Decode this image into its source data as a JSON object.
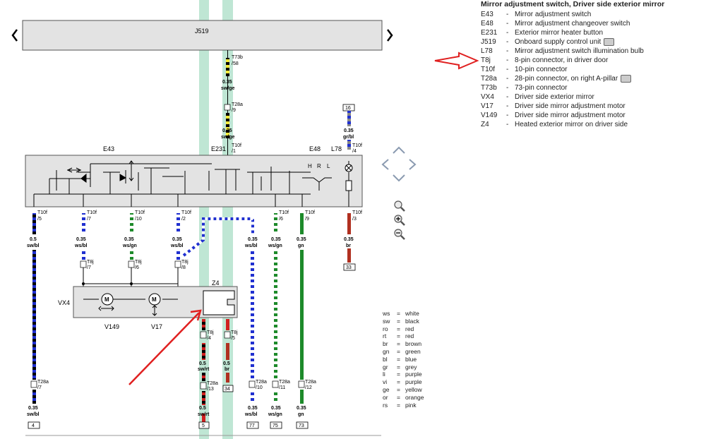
{
  "legend": {
    "title": "Mirror adjustment switch, Driver side exterior mirror",
    "items": [
      {
        "code": "E43",
        "desc": "Mirror adjustment switch",
        "camera": false
      },
      {
        "code": "E48",
        "desc": "Mirror adjustment changeover switch",
        "camera": false
      },
      {
        "code": "E231",
        "desc": "Exterior mirror heater button",
        "camera": false
      },
      {
        "code": "J519",
        "desc": "Onboard supply control unit",
        "camera": true
      },
      {
        "code": "L78",
        "desc": "Mirror adjustment switch illumination bulb",
        "camera": false
      },
      {
        "code": "T8j",
        "desc": "8-pin connector, in driver door",
        "camera": false
      },
      {
        "code": "T10f",
        "desc": "10-pin connector",
        "camera": false
      },
      {
        "code": "T28a",
        "desc": "28-pin connector, on right A-pillar",
        "camera": true
      },
      {
        "code": "T73b",
        "desc": "73-pin connector",
        "camera": false
      },
      {
        "code": "VX4",
        "desc": "Driver side exterior mirror",
        "camera": false
      },
      {
        "code": "V17",
        "desc": "Driver side mirror adjustment motor",
        "camera": false
      },
      {
        "code": "V149",
        "desc": "Driver side mirror adjustment motor",
        "camera": false
      },
      {
        "code": "Z4",
        "desc": "Heated exterior mirror on driver side",
        "camera": false
      }
    ]
  },
  "color_codes": [
    {
      "k": "ws",
      "v": "white"
    },
    {
      "k": "sw",
      "v": "black"
    },
    {
      "k": "ro",
      "v": "red"
    },
    {
      "k": "rt",
      "v": "red"
    },
    {
      "k": "br",
      "v": "brown"
    },
    {
      "k": "gn",
      "v": "green"
    },
    {
      "k": "bl",
      "v": "blue"
    },
    {
      "k": "gr",
      "v": "grey"
    },
    {
      "k": "li",
      "v": "purple"
    },
    {
      "k": "vi",
      "v": "purple"
    },
    {
      "k": "ge",
      "v": "yellow"
    },
    {
      "k": "or",
      "v": "orange"
    },
    {
      "k": "rs",
      "v": "pink"
    }
  ],
  "labels": {
    "j519": "J519",
    "e43": "E43",
    "e231": "E231",
    "e48": "E48",
    "l78": "L78",
    "vx4": "VX4",
    "v149": "V149",
    "v17": "V17",
    "z4": "Z4",
    "h": "H",
    "r": "R",
    "l": "L"
  },
  "top_wire": {
    "t73b": "T73b",
    "t73b_pin": "/58",
    "size1": "0.35",
    "color1": "sw/ge",
    "t28a": "T28a",
    "t28a_pin": "/9",
    "size2": "0.35",
    "color2": "sw/ge",
    "t10f": "T10f",
    "t10f_pin": "/1"
  },
  "l78_wire": {
    "term": "16",
    "size": "0.35",
    "color": "gr/bl",
    "t10f": "T10f",
    "pin": "/4"
  },
  "wires": [
    {
      "id": "w5",
      "t10f": "T10f",
      "t10f_pin": "/5",
      "size": "0.5",
      "color": "sw/bl",
      "t28a": "T28a",
      "t28a_pin": "/7",
      "bsize": "0.35",
      "bcolor": "sw/bl",
      "term": "4"
    },
    {
      "id": "w7",
      "t10f": "T10f",
      "t10f_pin": "/7",
      "size": "0.35",
      "color": "ws/bl",
      "t8j": "T8j",
      "t8j_pin": "/7"
    },
    {
      "id": "w10",
      "t10f": "T10f",
      "t10f_pin": "/10",
      "size": "0.35",
      "color": "ws/gn",
      "t8j": "T8j",
      "t8j_pin": "/6"
    },
    {
      "id": "w2",
      "t10f": "T10f",
      "t10f_pin": "/2",
      "size": "0.35",
      "color": "ws/bl",
      "t8j": "T8j",
      "t8j_pin": "/8"
    },
    {
      "id": "wz1",
      "size_top": "0.35",
      "color_top": "ws/bl",
      "t28a": "T28a",
      "t28a_pin": "/10",
      "bsize": "0.35",
      "bcolor": "ws/bl",
      "term": "77"
    },
    {
      "id": "w6",
      "t10f": "T10f",
      "t10f_pin": "/6",
      "size": "0.35",
      "color": "ws/gn",
      "t28a": "T28a",
      "t28a_pin": "/11",
      "bsize": "0.35",
      "bcolor": "ws/gn",
      "term": "75"
    },
    {
      "id": "w9",
      "t10f": "T10f",
      "t10f_pin": "/9",
      "size": "0.35",
      "color": "gn",
      "t28a": "T28a",
      "t28a_pin": "/12",
      "bsize": "0.35",
      "bcolor": "gn",
      "term": "73"
    },
    {
      "id": "w3",
      "t10f": "T10f",
      "t10f_pin": "/3",
      "size": "0.35",
      "color": "br",
      "term": "33"
    }
  ],
  "z4_wires": {
    "left": {
      "t8j": "T8j",
      "pin": "/4",
      "size": "0.5",
      "color": "sw/rt",
      "t28a": "T28a",
      "t28a_pin": "/13",
      "bsize": "0.5",
      "bcolor": "sw/rt",
      "term": "5"
    },
    "right": {
      "t8j": "T8j",
      "pin": "/5",
      "size": "0.5",
      "color": "br",
      "term": "34"
    }
  },
  "colors": {
    "accent_green": "#bfe6d4",
    "box_fill": "#e3e3e3",
    "arrow_red": "#e02020"
  }
}
